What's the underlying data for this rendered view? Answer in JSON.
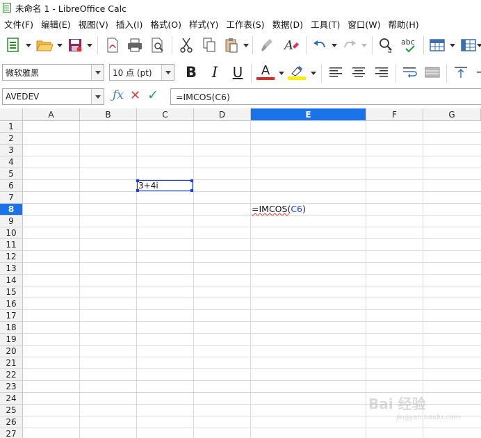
{
  "window": {
    "title": "未命名 1 - LibreOffice Calc"
  },
  "menu": [
    "文件(F)",
    "编辑(E)",
    "视图(V)",
    "插入(I)",
    "格式(O)",
    "样式(Y)",
    "工作表(S)",
    "数据(D)",
    "工具(T)",
    "窗口(W)",
    "帮助(H)"
  ],
  "formatting": {
    "font_name": "微软雅黑",
    "font_size": "10 点 (pt)",
    "bold": "B",
    "italic": "I",
    "underline": "U",
    "font_color_glyph": "A"
  },
  "formula_bar": {
    "name_box": "AVEDEV",
    "content": "=IMCOS(C6)"
  },
  "colors": {
    "active_header": "#1a73e8",
    "selection": "#1a3bd8",
    "font_color": "#d42a2a",
    "highlight": "#ffee00"
  },
  "columns": [
    "A",
    "B",
    "C",
    "D",
    "E",
    "F",
    "G"
  ],
  "active_column": "E",
  "rows": [
    "1",
    "2",
    "3",
    "4",
    "5",
    "6",
    "7",
    "8",
    "9",
    "10",
    "11",
    "12",
    "13",
    "14",
    "15",
    "16",
    "17",
    "18",
    "19",
    "20",
    "21",
    "22",
    "23",
    "24",
    "25",
    "26",
    "27"
  ],
  "active_row": "8",
  "cells": {
    "C6": "3+4i",
    "E8": {
      "prefix": "=IMCOS(",
      "ref": "C6",
      "suffix": ")"
    }
  },
  "watermark": {
    "text": "Bai 经验",
    "sub": "jingyan.baidu.com"
  }
}
